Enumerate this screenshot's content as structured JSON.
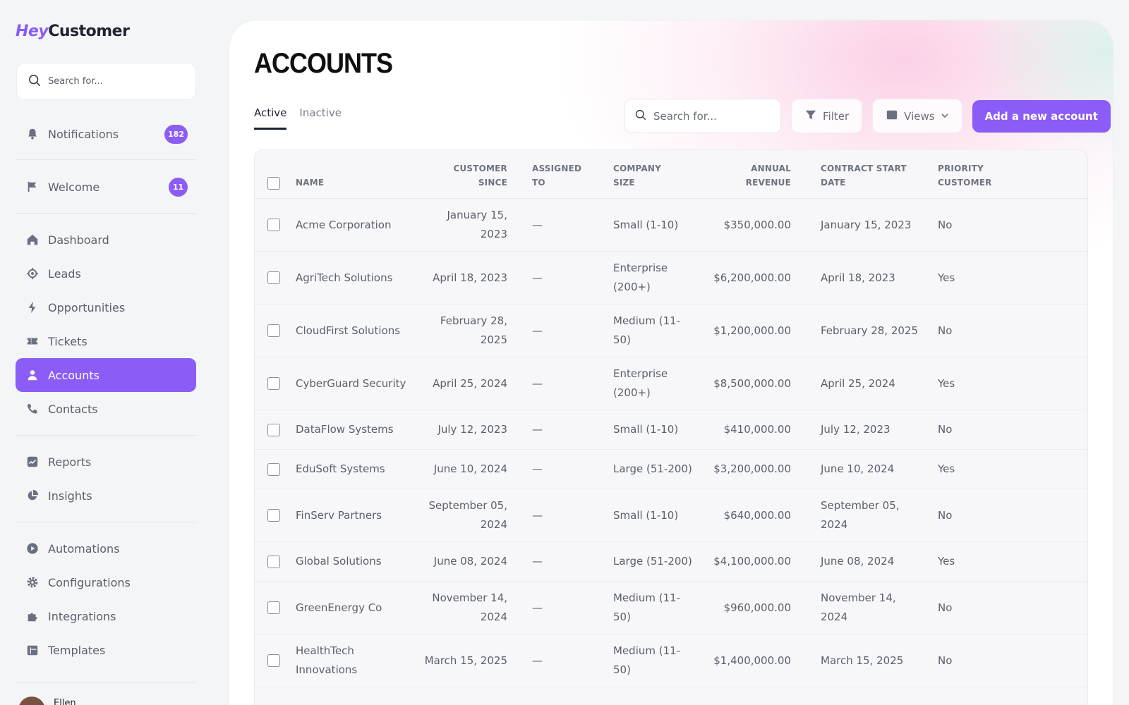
{
  "brand": {
    "logo_hey": "Hey",
    "logo_customer": "Customer"
  },
  "sidebar": {
    "search_placeholder": "Search for...",
    "notifications": {
      "label": "Notifications",
      "count": "182"
    },
    "welcome": {
      "label": "Welcome",
      "count": "11"
    },
    "nav": [
      {
        "label": "Dashboard",
        "icon": "home-icon"
      },
      {
        "label": "Leads",
        "icon": "target-icon"
      },
      {
        "label": "Opportunities",
        "icon": "bolt-icon"
      },
      {
        "label": "Tickets",
        "icon": "ticket-icon"
      },
      {
        "label": "Accounts",
        "icon": "user-icon",
        "active": true
      },
      {
        "label": "Contacts",
        "icon": "phone-icon"
      },
      {
        "label": "Reports",
        "icon": "chart-icon"
      },
      {
        "label": "Insights",
        "icon": "pie-icon"
      },
      {
        "label": "Automations",
        "icon": "play-icon"
      },
      {
        "label": "Configurations",
        "icon": "gear-icon"
      },
      {
        "label": "Integrations",
        "icon": "puzzle-icon"
      },
      {
        "label": "Templates",
        "icon": "template-icon"
      }
    ],
    "user": {
      "name": "Ellen"
    }
  },
  "main": {
    "title": "ACCOUNTS",
    "tabs": [
      "Active",
      "Inactive"
    ],
    "search_placeholder": "Search for...",
    "filter_label": "Filter",
    "views_label": "Views",
    "add_label": "Add a new account"
  },
  "table": {
    "headers": {
      "name": "NAME",
      "customer_since_1": "CUSTOMER",
      "customer_since_2": "SINCE",
      "assigned_1": "ASSIGNED",
      "assigned_2": "TO",
      "size_1": "COMPANY",
      "size_2": "SIZE",
      "revenue_1": "ANNUAL",
      "revenue_2": "REVENUE",
      "contract_1": "CONTRACT START",
      "contract_2": "DATE",
      "priority_1": "PRIORITY",
      "priority_2": "CUSTOMER"
    },
    "rows": [
      {
        "name": "Acme Corporation",
        "since": "January 15, 2023",
        "assigned": "—",
        "size": "Small (1-10)",
        "revenue": "$350,000.00",
        "contract": "January 15, 2023",
        "priority": "No"
      },
      {
        "name": "AgriTech Solutions",
        "since": "April 18, 2023",
        "assigned": "—",
        "size": "Enterprise (200+)",
        "revenue": "$6,200,000.00",
        "contract": "April 18, 2023",
        "priority": "Yes"
      },
      {
        "name": "CloudFirst Solutions",
        "since": "February 28, 2025",
        "assigned": "—",
        "size": "Medium (11-50)",
        "revenue": "$1,200,000.00",
        "contract": "February 28, 2025",
        "priority": "No"
      },
      {
        "name": "CyberGuard Security",
        "since": "April 25, 2024",
        "assigned": "—",
        "size": "Enterprise (200+)",
        "revenue": "$8,500,000.00",
        "contract": "April 25, 2024",
        "priority": "Yes"
      },
      {
        "name": "DataFlow Systems",
        "since": "July 12, 2023",
        "assigned": "—",
        "size": "Small (1-10)",
        "revenue": "$410,000.00",
        "contract": "July 12, 2023",
        "priority": "No"
      },
      {
        "name": "EduSoft Systems",
        "since": "June 10, 2024",
        "assigned": "—",
        "size": "Large (51-200)",
        "revenue": "$3,200,000.00",
        "contract": "June 10, 2024",
        "priority": "Yes"
      },
      {
        "name": "FinServ Partners",
        "since": "September 05, 2024",
        "assigned": "—",
        "size": "Small (1-10)",
        "revenue": "$640,000.00",
        "contract": "September 05, 2024",
        "priority": "No"
      },
      {
        "name": "Global Solutions",
        "since": "June 08, 2024",
        "assigned": "—",
        "size": "Large (51-200)",
        "revenue": "$4,100,000.00",
        "contract": "June 08, 2024",
        "priority": "Yes"
      },
      {
        "name": "GreenEnergy Co",
        "since": "November 14, 2024",
        "assigned": "—",
        "size": "Medium (11-50)",
        "revenue": "$960,000.00",
        "contract": "November 14, 2024",
        "priority": "No"
      },
      {
        "name": "HealthTech Innovations",
        "since": "March 15, 2025",
        "assigned": "—",
        "size": "Medium (11-50)",
        "revenue": "$1,400,000.00",
        "contract": "March 15, 2025",
        "priority": "No"
      }
    ]
  },
  "colors": {
    "accent": "#8b5cf6",
    "background": "#f4f5f6",
    "panel": "#ffffff"
  }
}
